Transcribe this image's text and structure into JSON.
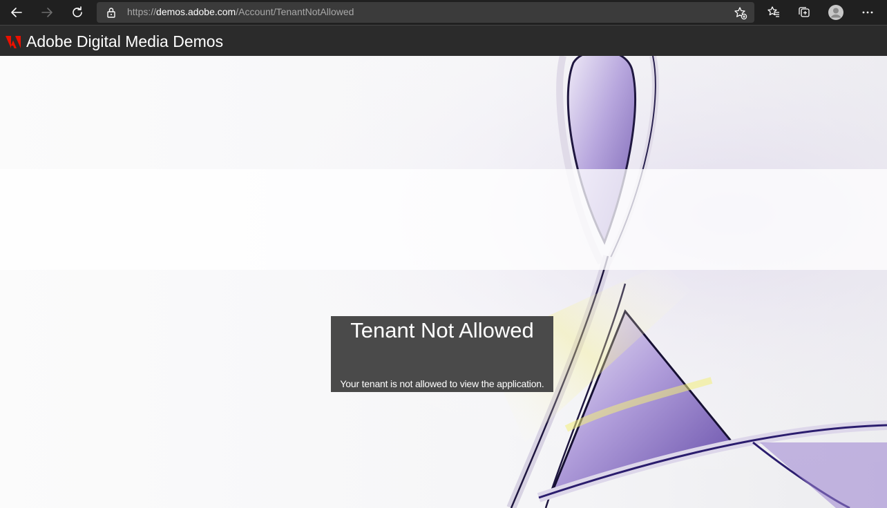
{
  "browser": {
    "url_prefix": "https://",
    "url_host": "demos.adobe.com",
    "url_path": "/Account/TenantNotAllowed",
    "icons": [
      "back-icon",
      "forward-icon",
      "refresh-icon",
      "lock-icon",
      "add-favorite-icon",
      "favorites-icon",
      "collections-icon",
      "profile-icon",
      "more-icon"
    ]
  },
  "header": {
    "title": "Adobe Digital Media Demos",
    "brand_color": "#eb1000"
  },
  "notice": {
    "title": "Tenant Not Allowed",
    "message": "Your tenant is not allowed to view the application."
  }
}
